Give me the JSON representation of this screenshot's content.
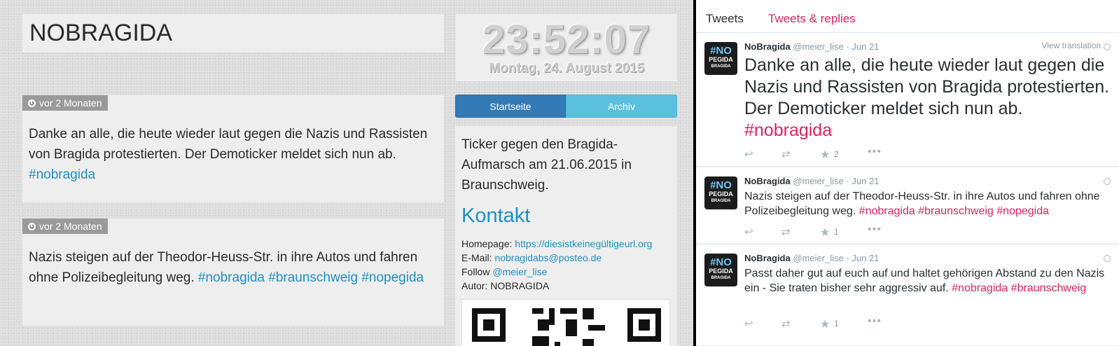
{
  "ticker": {
    "title": "NOBRAGIDA",
    "clock": {
      "time": "23:52:07",
      "date": "Montag, 24. August 2015"
    },
    "posts": [
      {
        "age": "vor 2 Monaten",
        "text": "Danke an alle, die heute wieder laut gegen die Nazis und Rassisten von Bragida protestierten. Der Demoticker meldet sich nun ab.",
        "tags": "#nobragida"
      },
      {
        "age": "vor 2 Monaten",
        "text": "Nazis steigen auf der Theodor-Heuss-Str. in ihre Autos und fahren ohne Polizeibegleitung weg.",
        "tags": "#nobragida #braunschweig #nopegida"
      }
    ],
    "nav": {
      "home": "Startseite",
      "archive": "Archiv"
    },
    "sidebar": {
      "description": "Ticker gegen den Bragida-Aufmarsch am 21.06.2015 in Braunschweig.",
      "contact_heading": "Kontakt",
      "homepage_label": "Homepage:",
      "homepage_url": "https://diesistkeinegültigeurl.org",
      "email_label": "E-Mail:",
      "email": "nobragidabs@posteo.de",
      "follow_label": "Follow",
      "follow_handle": "@meier_lise",
      "author_label": "Autor:",
      "author": "NOBRAGIDA"
    }
  },
  "twitter": {
    "tabs": {
      "tweets": "Tweets",
      "replies": "Tweets & replies"
    },
    "avatar": {
      "line1": "#NO",
      "line2": "PEGIDA",
      "line3": "BRAGIDA"
    },
    "view_translation": "View translation",
    "tweets": [
      {
        "name": "NoBragida",
        "handle": "@meier_lise",
        "date": "· Jun 21",
        "text": "Danke an alle, die heute wieder laut gegen die Nazis und Rassisten von Bragida protestierten. Der Demoticker meldet sich nun ab.",
        "tags": "#nobragida",
        "favorites": "2"
      },
      {
        "name": "NoBragida",
        "handle": "@meier_lise",
        "date": "· Jun 21",
        "text": "Nazis steigen auf der Theodor-Heuss-Str. in ihre Autos und fahren ohne Polizeibegleitung weg.",
        "tags": "#nobragida #braunschweig #nopegida",
        "favorites": "1"
      },
      {
        "name": "NoBragida",
        "handle": "@meier_lise",
        "date": "· Jun 21",
        "text": "Passt daher gut auf euch auf und haltet gehörigen Abstand zu den Nazis ein - Sie traten bisher sehr aggressiv auf.",
        "tags": "#nobragida #braunschweig",
        "favorites": "1"
      }
    ]
  },
  "colors": {
    "link_blue": "#1f8fc4",
    "twitter_red": "#e0245e",
    "nav_active": "#337ab7",
    "nav_inactive": "#5bc0de"
  }
}
